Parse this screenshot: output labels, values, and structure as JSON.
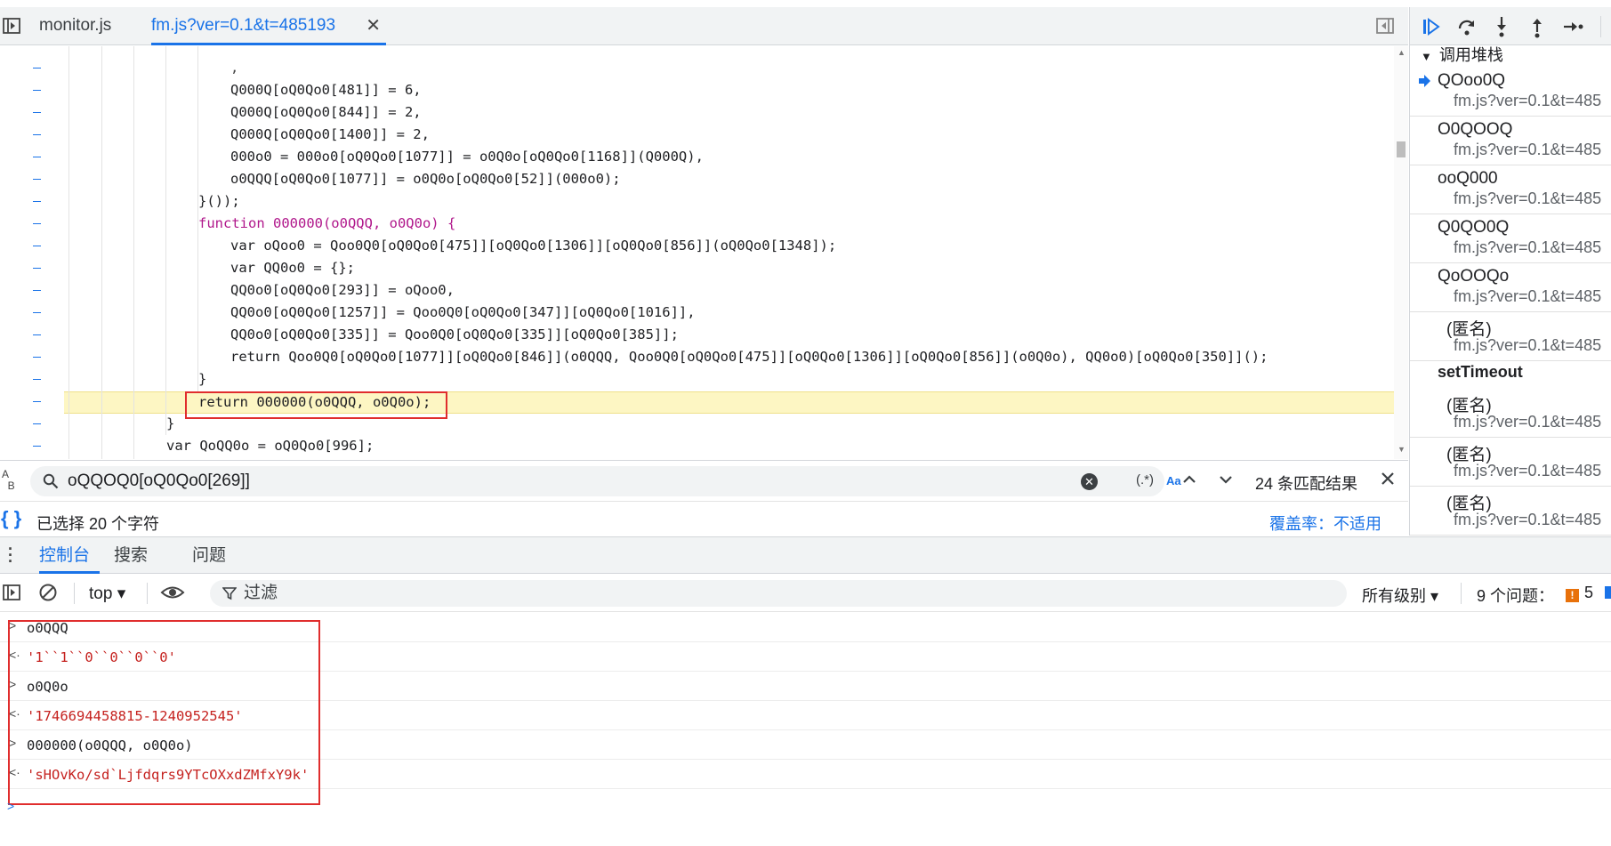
{
  "editor": {
    "tabs": [
      {
        "label": "monitor.js"
      },
      {
        "label": "fm.js?ver=0.1&t=485193",
        "close": "✕"
      }
    ],
    "lines": [
      ",",
      "Q000Q[oQ0Qo0[481]] = 6,",
      "Q000Q[oQ0Qo0[844]] = 2,",
      "Q000Q[oQ0Qo0[1400]] = 2,",
      "000o0 = 000o0[oQ0Qo0[1077]] = o0Q0o[oQ0Qo0[1168]](Q000Q),",
      "o0QQQ[oQ0Qo0[1077]] = o0Q0o[oQ0Qo0[52]](000o0);",
      "}());",
      "function 000000(o0QQQ, o0Q0o) {",
      "var oQoo0 = Qoo0Q0[oQ0Qo0[475]][oQ0Qo0[1306]][oQ0Qo0[856]](oQ0Qo0[1348]);",
      "var QQ0o0 = {};",
      "QQ0o0[oQ0Qo0[293]] = oQoo0,",
      "QQ0o0[oQ0Qo0[1257]] = Qoo0Q0[oQ0Qo0[347]][oQ0Qo0[1016]],",
      "QQ0o0[oQ0Qo0[335]] = Qoo0Q0[oQ0Qo0[335]][oQ0Qo0[385]];",
      "return Qoo0Q0[oQ0Qo0[1077]][oQ0Qo0[846]](o0QQQ, Qoo0Q0[oQ0Qo0[475]][oQ0Qo0[1306]][oQ0Qo0[856]](o0Q0o), QQ0o0)[oQ0Qo0[350]]();",
      "}",
      "return 000000(o0QQQ, o0Q0o);",
      "}",
      "var QoQQ0o = oQ0Qo0[996];"
    ]
  },
  "find": {
    "query": "oQQOQ0[oQ0Qo0[269]]",
    "regex_label": "(.*)",
    "case_label": "Aa",
    "match_count": "24 条匹配结果"
  },
  "status": {
    "selection": "已选择 20 个字符",
    "coverage": "覆盖率：不适用"
  },
  "callstack": {
    "header": "调用堆栈",
    "frames": [
      {
        "fn": "QOoo0Q",
        "loc": "fm.js?ver=0.1&t=485"
      },
      {
        "fn": "O0QOOQ",
        "loc": "fm.js?ver=0.1&t=485"
      },
      {
        "fn": "ooQ000",
        "loc": "fm.js?ver=0.1&t=485"
      },
      {
        "fn": "Q0QO0Q",
        "loc": "fm.js?ver=0.1&t=485"
      },
      {
        "fn": "QoOOQo",
        "loc": "fm.js?ver=0.1&t=485"
      },
      {
        "fn": "(匿名)",
        "loc": "fm.js?ver=0.1&t=485"
      }
    ],
    "section": "setTimeout",
    "frames2": [
      {
        "fn": "(匿名)",
        "loc": "fm.js?ver=0.1&t=485"
      },
      {
        "fn": "(匿名)",
        "loc": "fm.js?ver=0.1&t=485"
      },
      {
        "fn": "(匿名)",
        "loc": "fm.js?ver=0.1&t=485"
      }
    ]
  },
  "drawer": {
    "tabs": [
      "控制台",
      "搜索",
      "问题"
    ]
  },
  "console_toolbar": {
    "context": "top ▾",
    "filter_placeholder": "过滤",
    "levels": "所有级别 ▾",
    "issues_label": "9 个问题：",
    "issues_count": "5"
  },
  "console": {
    "entries": [
      {
        "kind": "in",
        "prefix": ">",
        "text": "o0QQQ"
      },
      {
        "kind": "out",
        "prefix": "<·",
        "text": "'1``1``0``0``0``0'"
      },
      {
        "kind": "in",
        "prefix": ">",
        "text": "o0Q0o"
      },
      {
        "kind": "out",
        "prefix": "<·",
        "text": "'1746694458815-1240952545'"
      },
      {
        "kind": "in",
        "prefix": ">",
        "text": "000000(o0QQQ, o0Q0o)"
      },
      {
        "kind": "out",
        "prefix": "<·",
        "text": "'sHOvKo/sd`Ljfdqrs9YTcOXxdZMfxY9k'"
      }
    ],
    "prompt": ">"
  },
  "colors": {
    "accent": "#1a73e8",
    "highlight_box": "#e02d2d",
    "paused_line": "#fdf6c3",
    "string_output": "#c5221f"
  }
}
